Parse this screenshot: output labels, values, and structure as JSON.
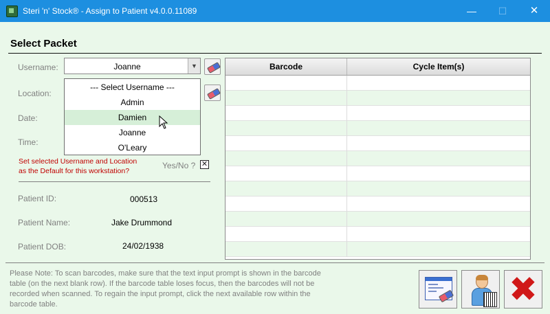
{
  "window": {
    "title": "Steri 'n' Stock® - Assign to Patient v4.0.0.11089",
    "min_glyph": "—",
    "max_glyph": "☐",
    "close_glyph": "✕"
  },
  "section": {
    "heading": "Select Packet"
  },
  "form": {
    "username_label": "Username:",
    "location_label": "Location:",
    "date_label": "Date:",
    "time_label": "Time:",
    "username_value": "Joanne",
    "dropdown_options": [
      "--- Select Username ---",
      "Admin",
      "Damien",
      "Joanne",
      "O'Leary"
    ],
    "dropdown_highlighted": "Damien",
    "default_prompt_line1": "Set selected Username and Location",
    "default_prompt_line2": "as the Default for this workstation?",
    "yesno_label": "Yes/No ?",
    "yesno_checked": true,
    "checkbox_glyph": "✕"
  },
  "patient": {
    "id_label": "Patient ID:",
    "id_value": "000513",
    "name_label": "Patient Name:",
    "name_value": "Jake Drummond",
    "dob_label": "Patient DOB:",
    "dob_value": "24/02/1938"
  },
  "table": {
    "columns": [
      "Barcode",
      "Cycle Item(s)"
    ],
    "rows": [
      [
        "",
        ""
      ],
      [
        "",
        ""
      ],
      [
        "",
        ""
      ],
      [
        "",
        ""
      ],
      [
        "",
        ""
      ],
      [
        "",
        ""
      ],
      [
        "",
        ""
      ],
      [
        "",
        ""
      ],
      [
        "",
        ""
      ],
      [
        "",
        ""
      ],
      [
        "",
        ""
      ],
      [
        "",
        ""
      ]
    ]
  },
  "note": "Please Note: To scan barcodes, make sure that the text input prompt is shown in the barcode table (on the next blank row). If the barcode table loses focus, then the barcodes will not be recorded when scanned. To regain the input prompt, click the next available row within the barcode table.",
  "buttons": {
    "clear_icon": "clear-form-icon",
    "assign_icon": "assign-patient-icon",
    "cancel_icon": "cancel-icon",
    "cancel_glyph": "✖"
  },
  "colors": {
    "titlebar": "#1d8fe0",
    "client_bg": "#eaf8ea",
    "warning_text": "#c00000",
    "highlight": "#d6efd8"
  }
}
